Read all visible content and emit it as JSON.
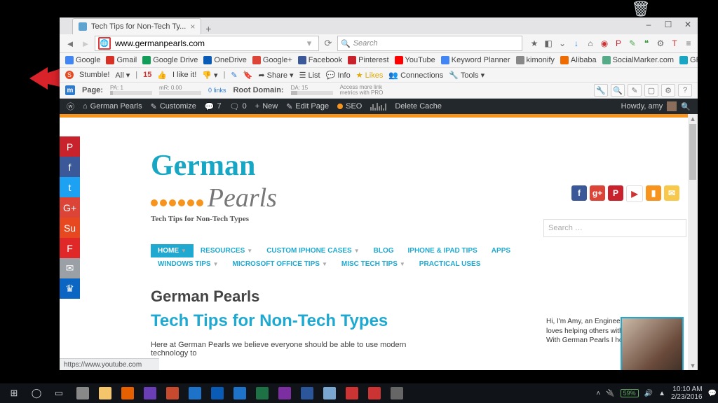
{
  "tab": {
    "title": "Tech Tips for Non-Tech Ty..."
  },
  "window_controls": {
    "min": "–",
    "max": "☐",
    "close": "✕"
  },
  "nav": {
    "url": "www.germanpearls.com",
    "search_placeholder": "Search",
    "right_icons": [
      {
        "name": "star-icon",
        "glyph": "★",
        "color": "#666"
      },
      {
        "name": "shield-icon",
        "glyph": "◧",
        "color": "#666"
      },
      {
        "name": "pocket-icon",
        "glyph": "⌄",
        "color": "#666"
      },
      {
        "name": "download-icon",
        "glyph": "↓",
        "color": "#2e7bd6"
      },
      {
        "name": "home-icon",
        "glyph": "⌂",
        "color": "#555"
      },
      {
        "name": "abp-icon",
        "glyph": "◉",
        "color": "#c33"
      },
      {
        "name": "pinterest-icon",
        "glyph": "P",
        "color": "#c8232c"
      },
      {
        "name": "evernote-icon",
        "glyph": "✎",
        "color": "#5a5"
      },
      {
        "name": "hangouts-icon",
        "glyph": "❝",
        "color": "#393"
      },
      {
        "name": "gear-icon",
        "glyph": "⚙",
        "color": "#666"
      },
      {
        "name": "t-icon",
        "glyph": "T",
        "color": "#c33"
      },
      {
        "name": "menu-icon",
        "glyph": "≡",
        "color": "#666"
      }
    ]
  },
  "bookmarks": [
    {
      "name": "google",
      "label": "Google",
      "color": "#4285f4"
    },
    {
      "name": "gmail",
      "label": "Gmail",
      "color": "#d93025"
    },
    {
      "name": "gdrive",
      "label": "Google Drive",
      "color": "#0f9d58"
    },
    {
      "name": "onedrive",
      "label": "OneDrive",
      "color": "#0a5bb5"
    },
    {
      "name": "gplus",
      "label": "Google+",
      "color": "#db4437"
    },
    {
      "name": "facebook",
      "label": "Facebook",
      "color": "#3b5998"
    },
    {
      "name": "pinterest",
      "label": "Pinterest",
      "color": "#c8232c"
    },
    {
      "name": "youtube",
      "label": "YouTube",
      "color": "#ff0000"
    },
    {
      "name": "kwplanner",
      "label": "Keyword Planner",
      "color": "#4285f4"
    },
    {
      "name": "kimonify",
      "label": "kimonify",
      "color": "#888"
    },
    {
      "name": "alibaba",
      "label": "Alibaba",
      "color": "#ef6b00"
    },
    {
      "name": "socialmarker",
      "label": "SocialMarker.com",
      "color": "#5a8"
    },
    {
      "name": "gpwebmail",
      "label": "GP Webmail",
      "color": "#17a7c4"
    }
  ],
  "stumble": {
    "brand": "Stumble!",
    "all": "All",
    "num": "15",
    "like": "I like it!",
    "share": "Share",
    "list": "List",
    "info": "Info",
    "likes": "Likes",
    "connections": "Connections",
    "tools": "Tools"
  },
  "moz": {
    "page_lbl": "Page:",
    "pa": "PA: 1",
    "mr": "mR: 0.00",
    "links": "0 links",
    "root_lbl": "Root Domain:",
    "da": "DA: 15",
    "access": "Access more link\nmetrics with PRO"
  },
  "wp": {
    "site": "German Pearls",
    "customize": "Customize",
    "comments": "7",
    "updates": "0",
    "new": "New",
    "edit": "Edit Page",
    "seo": "SEO",
    "delete": "Delete Cache",
    "howdy": "Howdy, amy"
  },
  "share_col": [
    {
      "name": "pinterest",
      "glyph": "P",
      "bg": "#c8232c"
    },
    {
      "name": "facebook",
      "glyph": "f",
      "bg": "#3b5998"
    },
    {
      "name": "twitter",
      "glyph": "t",
      "bg": "#1da1f2"
    },
    {
      "name": "gplus",
      "glyph": "G+",
      "bg": "#db4437"
    },
    {
      "name": "stumble",
      "glyph": "Su",
      "bg": "#e7481f"
    },
    {
      "name": "flipboard",
      "glyph": "F",
      "bg": "#e12828"
    },
    {
      "name": "email",
      "glyph": "✉",
      "bg": "#9aa0a6"
    },
    {
      "name": "sumome",
      "glyph": "♛",
      "bg": "#0b66c3"
    }
  ],
  "logo": {
    "part1": "German",
    "part2": "Pearls",
    "tag": "Tech Tips for Non-Tech Types"
  },
  "social_row": [
    {
      "name": "facebook",
      "glyph": "f",
      "bg": "#3b5998"
    },
    {
      "name": "gplus",
      "glyph": "g+",
      "bg": "#db4437"
    },
    {
      "name": "pinterest",
      "glyph": "P",
      "bg": "#c8232c"
    },
    {
      "name": "youtube",
      "glyph": "▶",
      "bg": "#fff",
      "fg": "#c33",
      "border": "1px solid #ddd"
    },
    {
      "name": "rss",
      "glyph": "▮",
      "bg": "#f7941d"
    },
    {
      "name": "contact",
      "glyph": "✉",
      "bg": "#f7c84a"
    }
  ],
  "searchbox_placeholder": "Search …",
  "menu": [
    {
      "label": "HOME",
      "caret": true,
      "active": true
    },
    {
      "label": "RESOURCES",
      "caret": true
    },
    {
      "label": "CUSTOM IPHONE CASES",
      "caret": true
    },
    {
      "label": "BLOG"
    },
    {
      "label": "IPHONE & IPAD TIPS"
    },
    {
      "label": "APPS"
    },
    {
      "label": "WINDOWS TIPS",
      "caret": true
    },
    {
      "label": "MICROSOFT OFFICE TIPS",
      "caret": true
    },
    {
      "label": "MISC TECH TIPS",
      "caret": true
    },
    {
      "label": "PRACTICAL USES"
    }
  ],
  "heading": "German Pearls",
  "subheading": "Tech Tips for Non-Tech Types",
  "intro": "Here at German Pearls we believe everyone should be able to use modern technology to",
  "about": "Hi, I'm Amy, an Engineer and tech-geek who loves helping others with tech problems. With German Pearls I hope to be able to",
  "status_url": "https://www.youtube.com",
  "taskbar": {
    "left": [
      {
        "name": "start",
        "glyph": "⊞"
      },
      {
        "name": "cortana",
        "glyph": "◯"
      },
      {
        "name": "taskview",
        "glyph": "▭"
      }
    ],
    "apps": [
      {
        "name": "store",
        "color": "#888"
      },
      {
        "name": "explorer",
        "color": "#f4c56b"
      },
      {
        "name": "firefox",
        "color": "#e66000"
      },
      {
        "name": "app2",
        "color": "#6a3fb5"
      },
      {
        "name": "app3",
        "color": "#c74a2f"
      },
      {
        "name": "mail",
        "color": "#1e73c9"
      },
      {
        "name": "outlook",
        "color": "#0a5bb5"
      },
      {
        "name": "edge",
        "color": "#1e73c9"
      },
      {
        "name": "excel",
        "color": "#1e7145"
      },
      {
        "name": "onenote",
        "color": "#7b2fa0"
      },
      {
        "name": "word",
        "color": "#2b579a"
      },
      {
        "name": "notepad",
        "color": "#7aa7cf"
      },
      {
        "name": "reader",
        "color": "#c33"
      },
      {
        "name": "app4",
        "color": "#c33"
      },
      {
        "name": "app5",
        "color": "#666"
      }
    ],
    "battery": "59%",
    "time": "10:10 AM",
    "date": "2/23/2016"
  }
}
